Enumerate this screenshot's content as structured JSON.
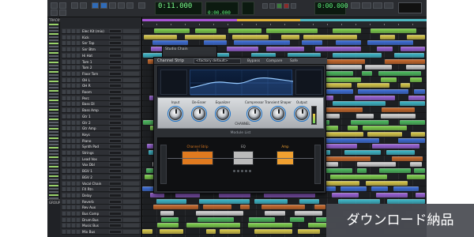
{
  "transport": {
    "main_counter": "0:11.000",
    "sub_counter": "0:00.000",
    "length_counter": "0:00.000"
  },
  "tracks_panel": {
    "title": "TRACKS"
  },
  "groups_panel": {
    "title": "GROUPS"
  },
  "tracks": [
    {
      "name": "Elec Kit (mix)"
    },
    {
      "name": "Kick"
    },
    {
      "name": "Snr Top"
    },
    {
      "name": "Snr Btm"
    },
    {
      "name": "Hi Hat"
    },
    {
      "name": "Tom 1"
    },
    {
      "name": "Tom 2"
    },
    {
      "name": "Floor Tom"
    },
    {
      "name": "OH L"
    },
    {
      "name": "OH R"
    },
    {
      "name": "Room"
    },
    {
      "name": "Perc"
    },
    {
      "name": "Bass DI"
    },
    {
      "name": "Bass Amp"
    },
    {
      "name": "Gtr 1"
    },
    {
      "name": "Gtr 2"
    },
    {
      "name": "Gtr Amp"
    },
    {
      "name": "Keys"
    },
    {
      "name": "Piano"
    },
    {
      "name": "Synth Pad"
    },
    {
      "name": "Strings"
    },
    {
      "name": "Lead Vox"
    },
    {
      "name": "Vox Dbl"
    },
    {
      "name": "BGV 1"
    },
    {
      "name": "BGV 2"
    },
    {
      "name": "Vocal Chain"
    },
    {
      "name": "FX Rtn"
    },
    {
      "name": "Delay"
    },
    {
      "name": "Reverb"
    },
    {
      "name": "Rev Aux"
    },
    {
      "name": "Bus Comp"
    },
    {
      "name": "Drum Bus"
    },
    {
      "name": "Music Bus"
    },
    {
      "name": "Mix Bus"
    }
  ],
  "plugin": {
    "title": "Channel Strip",
    "preset": "<factory default>",
    "buttons": [
      "Bypass",
      "Compare",
      "Safe"
    ],
    "knobs": [
      {
        "label": "Input"
      },
      {
        "label": "De-Esser"
      },
      {
        "label": "Equalizer"
      },
      {
        "label": "Compressor"
      },
      {
        "label": "Transient Shaper"
      },
      {
        "label": "Output"
      }
    ],
    "channel_label": "CHANNEL",
    "module_list_label": "Module List",
    "modules": [
      {
        "name": "Channel Strip 1",
        "color": "#e07a1f"
      },
      {
        "name": "EQ",
        "color": "#bbbbbb"
      },
      {
        "name": "Amp",
        "color": "#f0a030"
      }
    ]
  },
  "mini_window": {
    "title": "Studio Chain"
  },
  "banner": {
    "text": "ダウンロード納品"
  },
  "colors": {
    "accent_blue": "#1a73c9",
    "counter_green": "#5df07a",
    "clip_green": "#7fd14d",
    "clip_yellow": "#d8c84b",
    "clip_blue": "#3e6fd8",
    "clip_purple": "#9b63d8",
    "clip_cyan": "#3fb7c8"
  }
}
